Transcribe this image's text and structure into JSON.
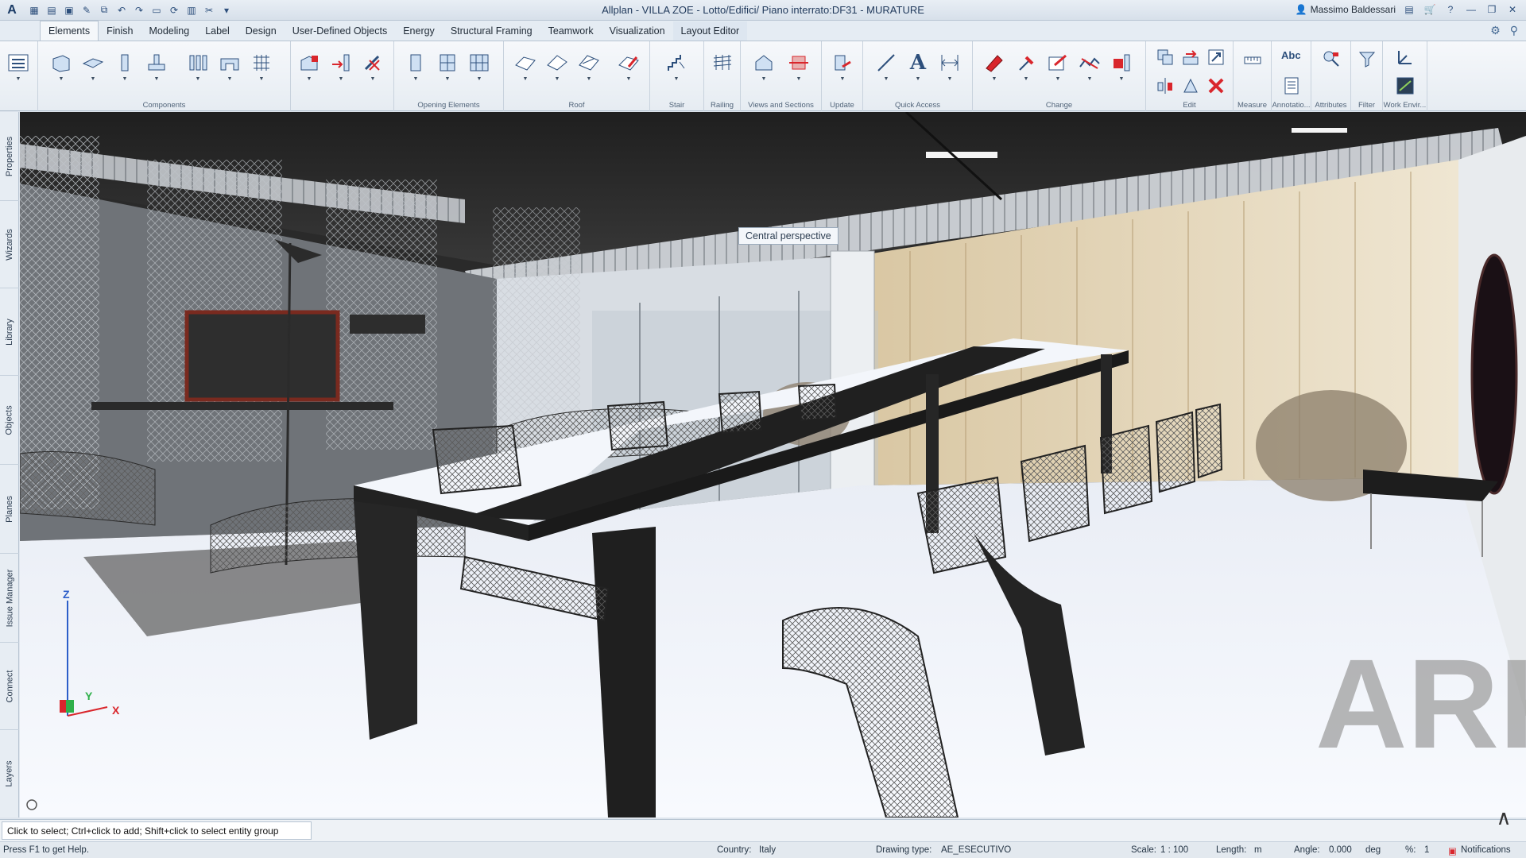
{
  "app": {
    "logo": "A",
    "title": "Allplan - VILLA ZOE - Lotto/Edifici/ Piano interrato:DF31 - MURATURE",
    "user": "Massimo Baldessari"
  },
  "tabs": [
    {
      "label": "Elements"
    },
    {
      "label": "Finish"
    },
    {
      "label": "Modeling"
    },
    {
      "label": "Label"
    },
    {
      "label": "Design"
    },
    {
      "label": "User-Defined Objects"
    },
    {
      "label": "Energy"
    },
    {
      "label": "Structural Framing"
    },
    {
      "label": "Teamwork"
    },
    {
      "label": "Visualization"
    },
    {
      "label": "Layout Editor"
    }
  ],
  "ribbon_groups": [
    {
      "label": "Components"
    },
    {
      "label": "Opening Elements"
    },
    {
      "label": "Roof"
    },
    {
      "label": "Stair"
    },
    {
      "label": "Railing"
    },
    {
      "label": "Views and Sections"
    },
    {
      "label": "Update"
    },
    {
      "label": "Quick Access"
    },
    {
      "label": "Change"
    },
    {
      "label": "Edit"
    },
    {
      "label": "Measure"
    },
    {
      "label": "Annotatio..."
    },
    {
      "label": "Attributes"
    },
    {
      "label": "Filter"
    },
    {
      "label": "Work Envir..."
    }
  ],
  "ribbon_text": {
    "abc": "Abc",
    "text_a": "A"
  },
  "side_tabs": [
    {
      "label": "Properties"
    },
    {
      "label": "Wizards"
    },
    {
      "label": "Library"
    },
    {
      "label": "Objects"
    },
    {
      "label": "Planes"
    },
    {
      "label": "Issue Manager"
    },
    {
      "label": "Connect"
    },
    {
      "label": "Layers"
    }
  ],
  "viewport": {
    "tooltip": "Central perspective",
    "axis": {
      "z": "Z",
      "y": "Y",
      "x": "X"
    },
    "watermark": "ARK"
  },
  "command_line": "Click to select; Ctrl+click to add; Shift+click to select entity group",
  "status": {
    "help": "Press F1 to get Help.",
    "country_label": "Country:",
    "country": "Italy",
    "drawing_type_label": "Drawing type:",
    "drawing_type": "AE_ESECUTIVO",
    "scale_label": "Scale:",
    "scale": "1 : 100",
    "length_label": "Length:",
    "length_unit": "m",
    "angle_label": "Angle:",
    "angle": "0.000",
    "angle_unit": "deg",
    "percent_label": "%:",
    "percent": "1",
    "notifications": "Notifications"
  },
  "colors": {
    "accent": "#2d4f7c",
    "delete_red": "#d9262c",
    "ribbon_bg": "#eef2f6"
  }
}
